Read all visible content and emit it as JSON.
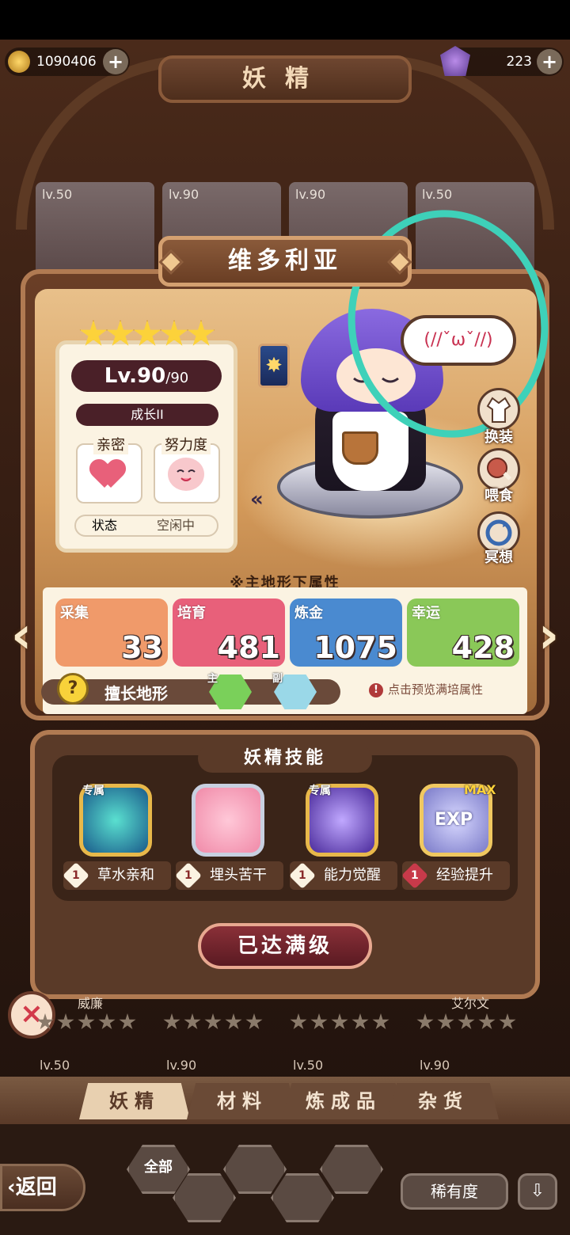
{
  "resources": {
    "gold": "1090406",
    "gems": "223"
  },
  "header": {
    "title": "妖精"
  },
  "back_row": {
    "levels": [
      "lv.50",
      "lv.90",
      "lv.90",
      "lv.50"
    ]
  },
  "fairy": {
    "name": "维多利亚",
    "stars": 5,
    "level": "Lv.90",
    "max_level": "/90",
    "growth": "成长II",
    "intimacy_label": "亲密",
    "effort_label": "努力度",
    "status_label": "状态",
    "status_value": "空闲中",
    "speech": "(//ˇωˇ//)"
  },
  "actions": {
    "dress": "换装",
    "feed": "喂食",
    "meditate": "冥想"
  },
  "attributes": {
    "title": "※主地形下属性",
    "items": [
      {
        "name": "采集",
        "value": "33",
        "color": "#f09a6a"
      },
      {
        "name": "培育",
        "value": "481",
        "color": "#e8607a"
      },
      {
        "name": "炼金",
        "value": "1075",
        "color": "#4a8ad0"
      },
      {
        "name": "幸运",
        "value": "428",
        "color": "#8ac858"
      }
    ],
    "terrain_label": "擅长地形",
    "main_tag": "主",
    "sub_tag": "副",
    "preview_hint": "点击预览满培属性"
  },
  "skills": {
    "title": "妖精技能",
    "exclusive_tag": "专属",
    "max_tag": "MAX",
    "exp_text": "EXP",
    "items": [
      {
        "name": "草水亲和",
        "num": "1"
      },
      {
        "name": "埋头苦干",
        "num": "1"
      },
      {
        "name": "能力觉醒",
        "num": "1"
      },
      {
        "name": "经验提升",
        "num": "1"
      }
    ]
  },
  "max_button": "已达满级",
  "lower_row": {
    "names": [
      "威廉",
      "",
      "",
      "艾尔文"
    ],
    "levels": [
      "lv.50",
      "lv.90",
      "lv.50",
      "lv.90"
    ]
  },
  "tabs": [
    "妖精",
    "材料",
    "炼成品",
    "杂货"
  ],
  "filter": {
    "back": "返回",
    "all": "全部",
    "rarity": "稀有度"
  },
  "colors": {
    "annotation": "#3ed1b9",
    "accent": "#e8b84a"
  }
}
